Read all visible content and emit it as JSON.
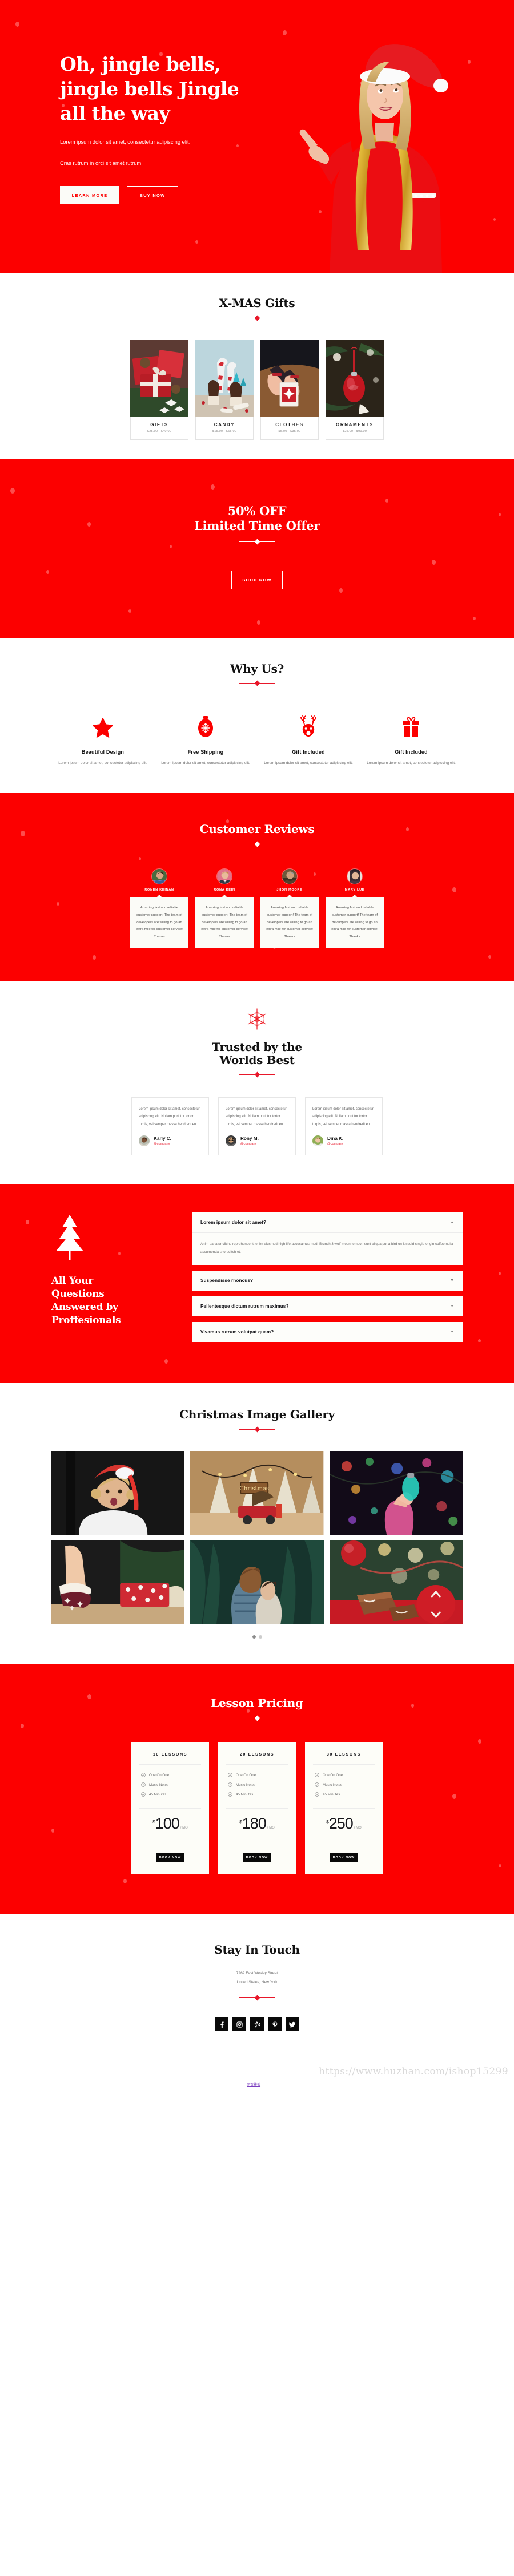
{
  "hero": {
    "heading_line1": "Oh, jingle bells,",
    "heading_line2": "jingle bells Jingle",
    "heading_line3": "all the way",
    "para1": "Lorem ipsum dolor sit amet, consectetur adipiscing elit.",
    "para2": "Cras rutrum in orci sit amet rutrum.",
    "btn_primary": "LEARN MORE",
    "btn_secondary": "BUY NOW",
    "bg_color": "#fc0000",
    "image_alt": "woman-in-santa-hat-pointing-up"
  },
  "gifts": {
    "title": "X-MAS Gifts",
    "cards": [
      {
        "name": "GIFTS",
        "price": "$25.00 - $40.00",
        "image_alt": "red-wrapped-presents-with-pinecones"
      },
      {
        "name": "CANDY",
        "price": "$15.00 - $55.00",
        "image_alt": "candy-canes-and-cupcakes"
      },
      {
        "name": "CLOTHES",
        "price": "$5.00 - $35.00",
        "image_alt": "hands-holding-small-gift-box"
      },
      {
        "name": "ORNAMENTS",
        "price": "$25.00 - $99.00",
        "image_alt": "red-joy-bauble-on-tree"
      }
    ]
  },
  "offer": {
    "line1": "50% OFF",
    "line2": "Limited Time Offer",
    "button": "SHOP NOW"
  },
  "why": {
    "title": "Why Us?",
    "features": [
      {
        "icon": "star-icon",
        "title": "Beautiful Design",
        "text": "Lorem ipsum dolor sit amet, consectetur adipiscing elit."
      },
      {
        "icon": "bauble-icon",
        "title": "Free Shipping",
        "text": "Lorem ipsum dolor sit amet, consectetur adipiscing elit."
      },
      {
        "icon": "reindeer-icon",
        "title": "Gift Included",
        "text": "Lorem ipsum dolor sit amet, consectetur adipiscing elit."
      },
      {
        "icon": "gift-icon",
        "title": "Gift Included",
        "text": "Lorem ipsum dolor sit amet, consectetur adipiscing elit."
      }
    ]
  },
  "reviews": {
    "title": "Customer Reviews",
    "items": [
      {
        "name": "RONEN KEINAN",
        "text": "Amazing fast and reliable customer support! The team of developers are willing to go an extra mile for customer service! Thanks"
      },
      {
        "name": "RONA KEIN",
        "text": "Amazing fast and reliable customer support! The team of developers are willing to go an extra mile for customer service! Thanks"
      },
      {
        "name": "JHON MOORE",
        "text": "Amazing fast and reliable customer support! The team of developers are willing to go an extra mile for customer service! Thanks"
      },
      {
        "name": "MARY LUE",
        "text": "Amazing fast and reliable customer support! The team of developers are willing to go an extra mile for customer service! Thanks"
      }
    ]
  },
  "trusted": {
    "title_line1": "Trusted by the",
    "title_line2": "Worlds Best",
    "icon": "snowflake-icon",
    "cards": [
      {
        "text": "Lorem ipsum dolor sit amet, consectetur adipiscing elit. Nullam porttitor tortor turpis, vel semper massa hendrerit eu.",
        "name": "Karly C.",
        "company": "@company"
      },
      {
        "text": "Lorem ipsum dolor sit amet, consectetur adipiscing elit. Nullam porttitor tortor turpis, vel semper massa hendrerit eu.",
        "name": "Rony M.",
        "company": "@company"
      },
      {
        "text": "Lorem ipsum dolor sit amet, consectetur adipiscing elit. Nullam porttitor tortor turpis, vel semper massa hendrerit eu.",
        "name": "Dina K.",
        "company": "@company"
      }
    ]
  },
  "faq": {
    "heading_line1": "All Your",
    "heading_line2": "Questions",
    "heading_line3": "Answered by",
    "heading_line4": "Proffesionals",
    "icon": "christmas-tree-icon",
    "items": [
      {
        "question": "Lorem ipsum dolor sit amet?",
        "answer": "Anim pariatur cliche reprehenderit, enim eiusmod high life accusamus mod. Brunch 3 wolf moon tempor, sunt aliqua put a bird on it squid single-origin coffee nulla assumenda shoreditch et.",
        "open": true,
        "chevron": "chevron-up-icon"
      },
      {
        "question": "Suspendisse rhoncus?",
        "answer": "",
        "open": false,
        "chevron": "chevron-down-icon"
      },
      {
        "question": "Pellentesque dictum rutrum maximus?",
        "answer": "",
        "open": false,
        "chevron": "chevron-down-icon"
      },
      {
        "question": "Vivamus rutrum volutpat quam?",
        "answer": "",
        "open": false,
        "chevron": "chevron-down-icon"
      }
    ]
  },
  "gallery": {
    "title": "Christmas Image Gallery",
    "images": [
      "woman-in-santa-hat-against-black-wall",
      "miniature-christmas-village-with-red-truck",
      "hand-holding-glowing-christmas-bulb",
      "feet-in-star-socks-near-presents",
      "couple-embracing-by-christmas-tree",
      "fudge-slices-and-snowflake-bauble"
    ],
    "dots": 2,
    "active_dot": 1
  },
  "pricing": {
    "title": "Lesson Pricing",
    "plans": [
      {
        "tier": "10 LESSONS",
        "features": [
          "One On One",
          "Music Notes",
          "45 Minutes"
        ],
        "currency": "$",
        "amount": "100",
        "period": "/ MO",
        "button": "BOOK NOW"
      },
      {
        "tier": "20 LESSONS",
        "features": [
          "One On One",
          "Music Notes",
          "45 Minutes"
        ],
        "currency": "$",
        "amount": "180",
        "period": "/ MO",
        "button": "BOOK NOW"
      },
      {
        "tier": "30 LESSONS",
        "features": [
          "One On One",
          "Music Notes",
          "45 Minutes"
        ],
        "currency": "$",
        "amount": "250",
        "period": "/ MO",
        "button": "BOOK NOW"
      }
    ]
  },
  "footer": {
    "title": "Stay In Touch",
    "address_line1": "7262 East Wesley Street",
    "address_line2": "United States, New York",
    "socials": [
      {
        "icon": "facebook-icon",
        "label": "Facebook"
      },
      {
        "icon": "instagram-icon",
        "label": "Instagram"
      },
      {
        "icon": "yelp-icon",
        "label": "Yelp"
      },
      {
        "icon": "pinterest-icon",
        "label": "Pinterest"
      },
      {
        "icon": "twitter-icon",
        "label": "Twitter"
      }
    ]
  },
  "watermark": {
    "url": "https://www.huzhan.com/ishop15299",
    "tag": "网页模板"
  },
  "colors": {
    "brand_red": "#fc0000",
    "accent_red": "#e8172a",
    "ink": "#111111",
    "cream": "#fbfbf7"
  }
}
